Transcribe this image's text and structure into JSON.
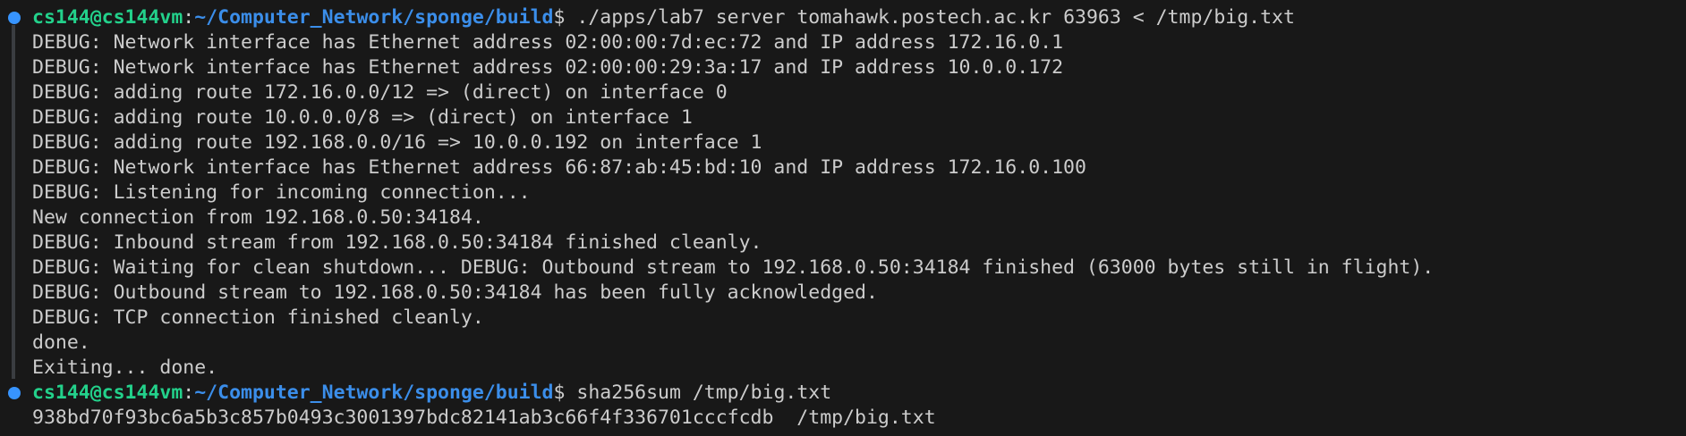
{
  "prompt": {
    "user_host": "cs144@cs144vm",
    "separator": ":",
    "path": "~/Computer_Network/sponge/build",
    "symbol": "$"
  },
  "commands": {
    "cmd1": " ./apps/lab7 server tomahawk.postech.ac.kr 63963 < /tmp/big.txt",
    "cmd2": " sha256sum /tmp/big.txt"
  },
  "output1": [
    "DEBUG: Network interface has Ethernet address 02:00:00:7d:ec:72 and IP address 172.16.0.1",
    "DEBUG: Network interface has Ethernet address 02:00:00:29:3a:17 and IP address 10.0.0.172",
    "DEBUG: adding route 172.16.0.0/12 => (direct) on interface 0",
    "DEBUG: adding route 10.0.0.0/8 => (direct) on interface 1",
    "DEBUG: adding route 192.168.0.0/16 => 10.0.0.192 on interface 1",
    "DEBUG: Network interface has Ethernet address 66:87:ab:45:bd:10 and IP address 172.16.0.100",
    "DEBUG: Listening for incoming connection...",
    "New connection from 192.168.0.50:34184.",
    "DEBUG: Inbound stream from 192.168.0.50:34184 finished cleanly.",
    "DEBUG: Waiting for clean shutdown... DEBUG: Outbound stream to 192.168.0.50:34184 finished (63000 bytes still in flight).",
    "DEBUG: Outbound stream to 192.168.0.50:34184 has been fully acknowledged.",
    "DEBUG: TCP connection finished cleanly.",
    "done.",
    "Exiting... done."
  ],
  "output2": [
    "938bd70f93bc6a5b3c857b0493c3001397bdc82141ab3c66f4f336701cccfcdb  /tmp/big.txt"
  ],
  "colors": {
    "background": "#181818",
    "text": "#cccccc",
    "user_host": "#23d18b",
    "path": "#3b8eea",
    "marker": "#3794ff"
  }
}
